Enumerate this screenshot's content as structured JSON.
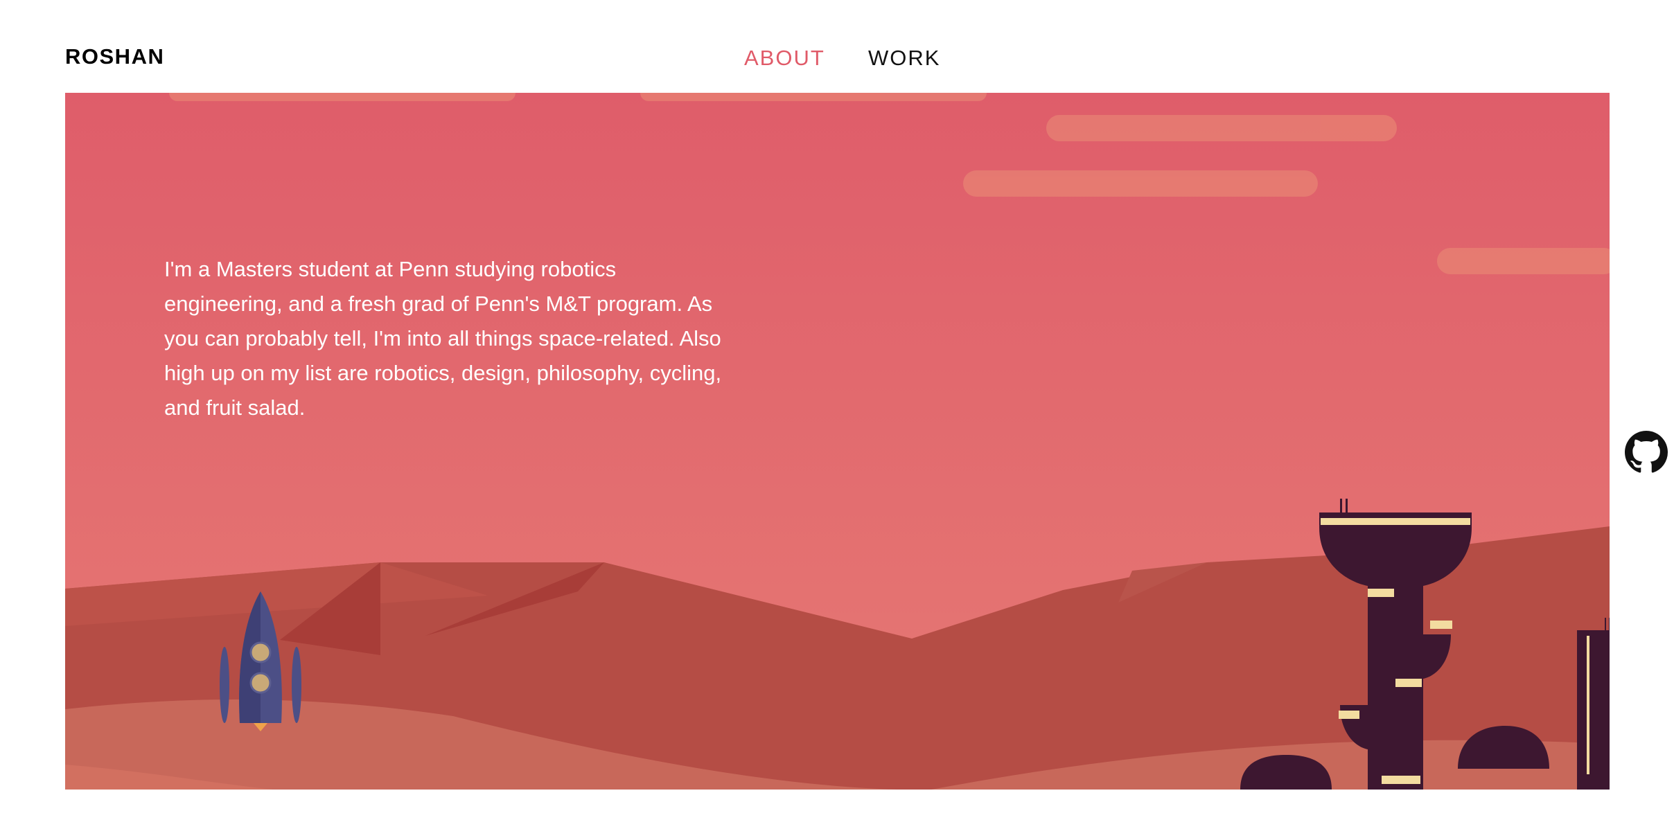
{
  "header": {
    "logo": "ROSHAN",
    "nav": [
      {
        "label": "ABOUT",
        "active": true
      },
      {
        "label": "WORK",
        "active": false
      }
    ]
  },
  "hero": {
    "intro": "I'm a Masters student at Penn studying robotics engineering, and a fresh grad of Penn's M&T program. As you can probably tell, I'm into all things space-related. Also high up on my list are robotics, design, philosophy, cycling, and fruit salad."
  },
  "icons": {
    "social": "github-icon"
  },
  "colors": {
    "accent": "#e05a68",
    "sky": "#e1636c",
    "mountain": "#b54d45",
    "dune": "#c8685a",
    "tower": "#3d1730",
    "window": "#f3dca0",
    "rocket": "#4c4f86"
  }
}
